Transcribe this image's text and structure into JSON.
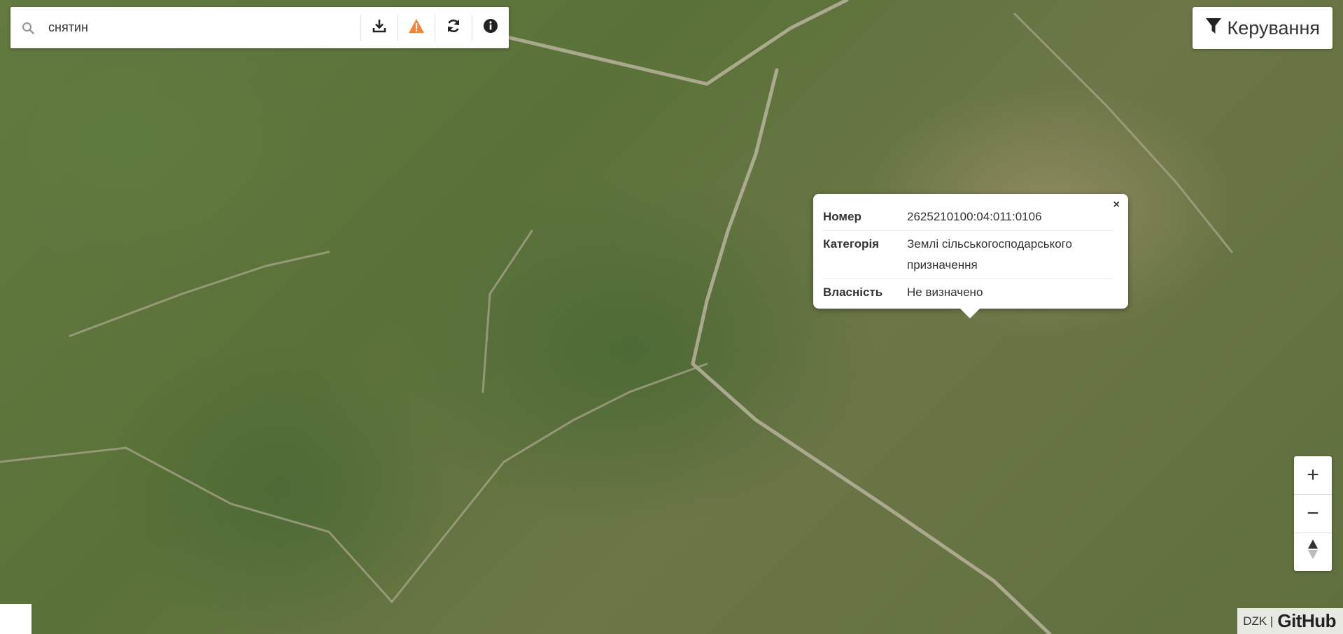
{
  "search": {
    "query": "снятин",
    "placeholder": ""
  },
  "toolbar": {
    "download_icon": "download-icon",
    "warning_icon": "warning-icon",
    "refresh_icon": "refresh-icon",
    "info_icon": "info-icon"
  },
  "control": {
    "label": "Керування",
    "icon": "filter-icon"
  },
  "popup": {
    "close_label": "×",
    "rows": [
      {
        "key": "Номер",
        "value": "2625210100:04:011:0106"
      },
      {
        "key": "Категорія",
        "value": "Землі сільськогосподарського призначення"
      },
      {
        "key": "Власність",
        "value": "Не визначено"
      }
    ]
  },
  "zoom": {
    "in_label": "+",
    "out_label": "−",
    "north_icon": "compass-icon"
  },
  "attribution": {
    "text": "DZK |",
    "github": "GitHub"
  },
  "colors": {
    "parcel_blue": "#2896c8",
    "parcel_teal": "#1eb996",
    "selected_parcel": "#1ea5dc",
    "warning": "#f0863c"
  }
}
